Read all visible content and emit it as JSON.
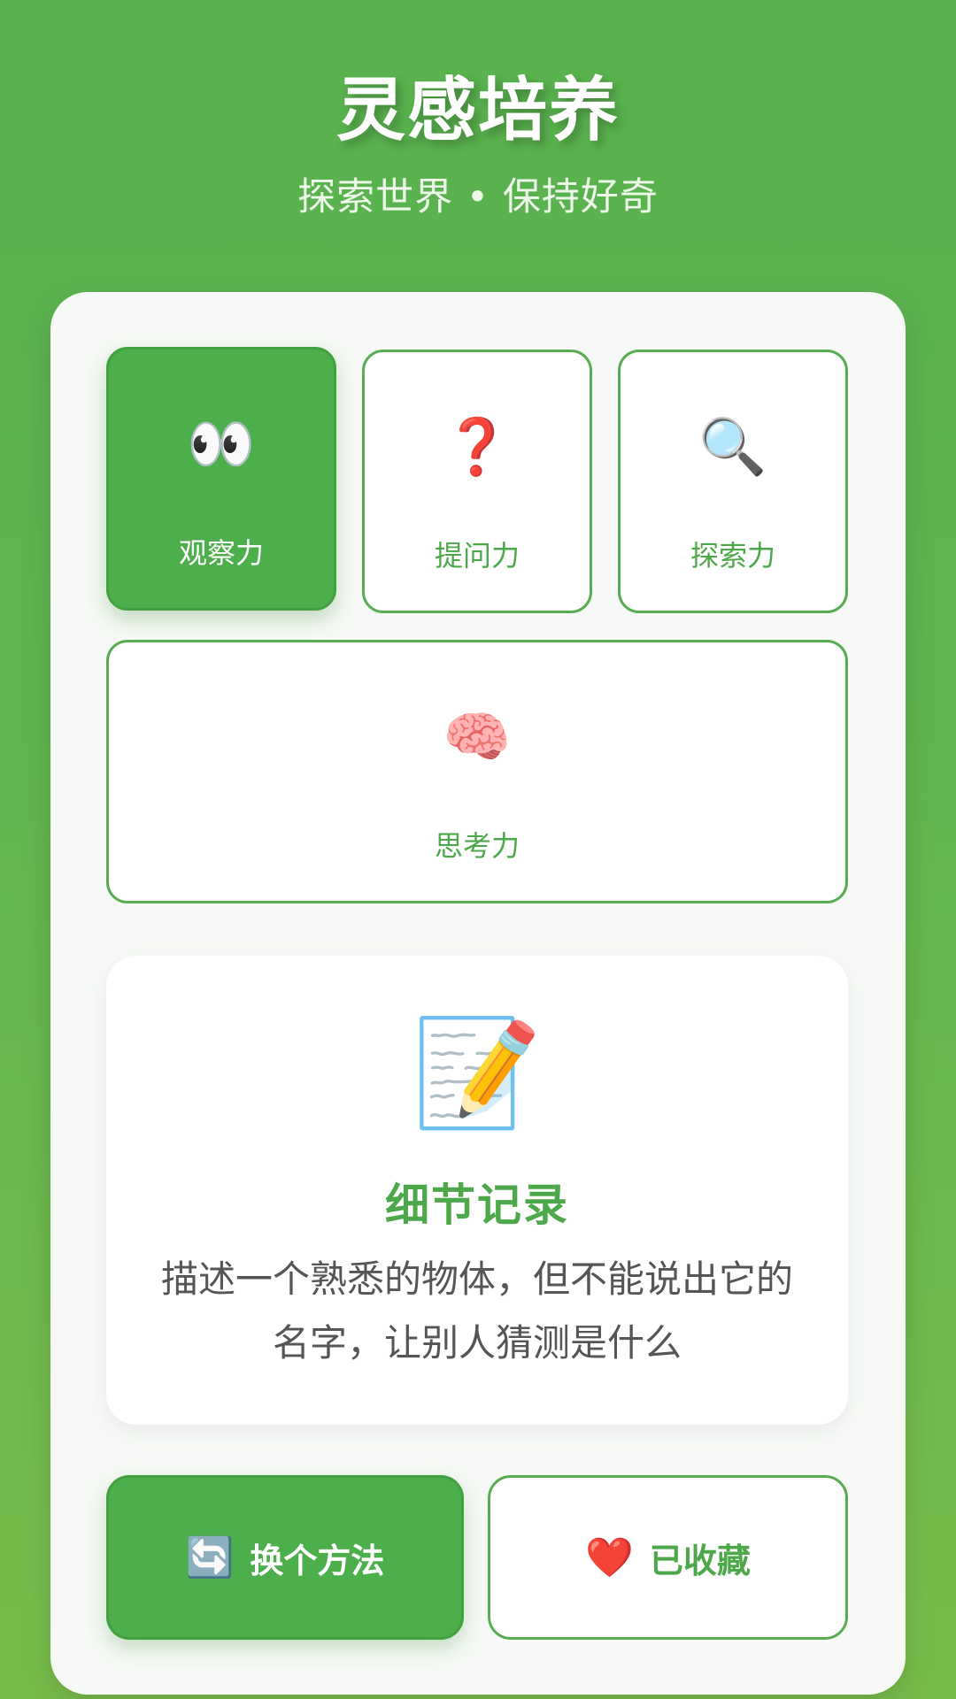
{
  "header": {
    "title": "灵感培养",
    "subtitle": "探索世界 • 保持好奇"
  },
  "categories": [
    {
      "icon": "👀",
      "icon_name": "eyes-icon",
      "label": "观察力",
      "active": true
    },
    {
      "icon": "❓",
      "icon_name": "question-mark-icon",
      "label": "提问力",
      "active": false
    },
    {
      "icon": "🔍",
      "icon_name": "magnifier-icon",
      "label": "探索力",
      "active": false
    },
    {
      "icon": "🧠",
      "icon_name": "brain-icon",
      "label": "思考力",
      "active": false
    }
  ],
  "method": {
    "icon": "📝",
    "icon_name": "memo-pencil-icon",
    "title": "细节记录",
    "description": "描述一个熟悉的物体，但不能说出它的名字，让别人猜测是什么"
  },
  "actions": {
    "switch_icon": "🔄",
    "switch_label": "换个方法",
    "favorite_icon": "❤️",
    "favorite_label": "已收藏"
  },
  "colors": {
    "accent": "#4caf4b",
    "accent_text": "#4ca849",
    "background_top": "#58b24e",
    "background_bottom": "#77bb4a",
    "card_bg": "#f6f9f5"
  }
}
